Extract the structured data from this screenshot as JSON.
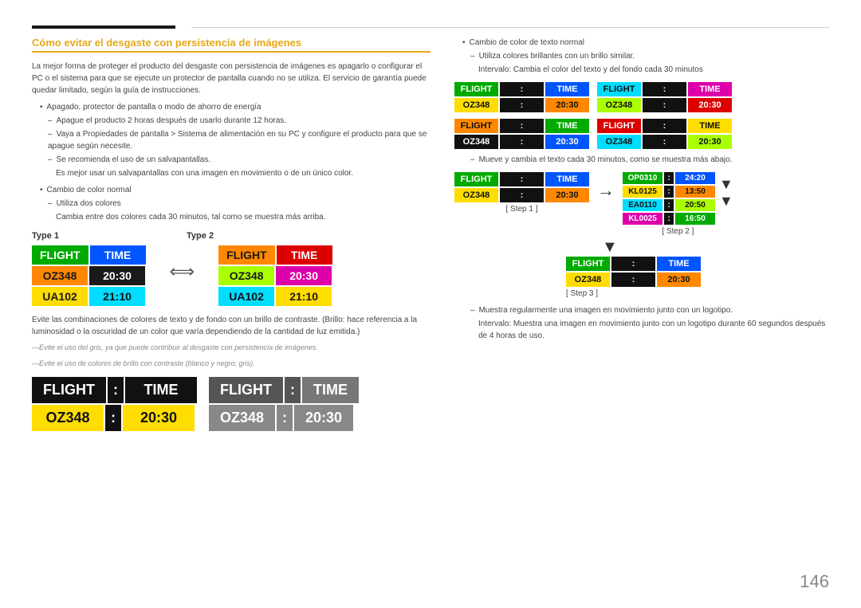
{
  "page": {
    "number": "146"
  },
  "heading": {
    "title": "Cómo evitar el desgaste con persistencia de imágenes"
  },
  "left_col": {
    "intro": "La mejor forma de proteger el producto del desgaste con persistencia de imágenes es apagarlo o configurar el PC o el sistema para que se ejecute un protector de pantalla cuando no se utiliza. El servicio de garantía puede quedar limitado, según la guía de instrucciones.",
    "bullet1": "Apagado, protector de pantalla o modo de ahorro de energía",
    "dash1": "Apague el producto 2 horas después de usarlo durante 12 horas.",
    "dash2": "Vaya a Propiedades de pantalla > Sistema de alimentación en su PC y configure el producto para que se apague según necesite.",
    "dash3": "Se recomienda el uso de un salvapantallas.",
    "dash3b": "Es mejor usar un salvapantallas con una imagen en movimiento o de un único color.",
    "bullet2": "Cambio de color normal",
    "dash4": "Utiliza dos colores",
    "dash4b": "Cambia entre dos colores cada 30 minutos, tal como se muestra más arriba.",
    "type1_label": "Type 1",
    "type2_label": "Type 2",
    "board1": {
      "header": [
        "FLIGHT",
        "TIME"
      ],
      "row1": [
        "OZ348",
        "20:30"
      ],
      "row2": [
        "UA102",
        "21:10"
      ]
    },
    "board2": {
      "header": [
        "FLIGHT",
        "TIME"
      ],
      "row1": [
        "OZ348",
        "20:30"
      ],
      "row2": [
        "UA102",
        "21:10"
      ]
    },
    "note1": "Evite las combinaciones de colores de texto y de fondo con un brillo de contraste. (Brillo: hace referencia a la luminosidad o la oscuridad de un color que varía dependiendo de la cantidad de luz emitida.)",
    "note2": "Evite el uso del gris, ya que puede contribuir al desgaste con persistencia de imágenes.",
    "note3": "Evite el uso de colores de brillo con contraste (blanco y negro; gris).",
    "bottom_board1": {
      "header": [
        "FLIGHT",
        "TIME"
      ],
      "row1": [
        "OZ348",
        "20:30"
      ]
    },
    "bottom_board2": {
      "header": [
        "FLIGHT",
        "TIME"
      ],
      "row1": [
        "OZ348",
        "20:30"
      ]
    }
  },
  "right_col": {
    "bullet1": "Cambio de color de texto normal",
    "dash1": "Utiliza colores brillantes con un brillo similar.",
    "dash1b": "Intervalo: Cambia el color del texto y del fondo cada 30 minutos",
    "board_row1_left": {
      "header": [
        "FLIGHT",
        "TIME"
      ],
      "row1": [
        "OZ348",
        "20:30"
      ]
    },
    "board_row1_right": {
      "header": [
        "FLIGHT",
        "TIME"
      ],
      "row1": [
        "OZ348",
        "20:30"
      ]
    },
    "board_row2_left": {
      "header": [
        "FLIGHT",
        "TIME"
      ],
      "row1": [
        "OZ348",
        "20:30"
      ]
    },
    "board_row2_right": {
      "header": [
        "FLIGHT",
        "TIME"
      ],
      "row1": [
        "OZ348",
        "20:30"
      ]
    },
    "dash2": "Mueve y cambia el texto cada 30 minutos, como se muestra más abajo.",
    "step1_label": "[ Step 1 ]",
    "step2_label": "[ Step 2 ]",
    "step3_label": "[ Step 3 ]",
    "step1_board": {
      "header": [
        "FLIGHT",
        "TIME"
      ],
      "row1": [
        "OZ348",
        "20:30"
      ]
    },
    "step2_board": {
      "rows": [
        [
          "OP0310",
          "24:20"
        ],
        [
          "KL0125",
          "13:50"
        ],
        [
          "EA0110",
          "20:50"
        ],
        [
          "KL0025",
          "16:50"
        ]
      ]
    },
    "step3_board": {
      "header": [
        "FLIGHT",
        "TIME"
      ],
      "row1": [
        "OZ348",
        "20:30"
      ]
    },
    "note1": "Muestra regularmente una imagen en movimiento junto con un logotipo.",
    "note2": "Intervalo: Muestra una imagen en movimiento junto con un logotipo durante 60 segundos después de 4 horas de uso."
  }
}
